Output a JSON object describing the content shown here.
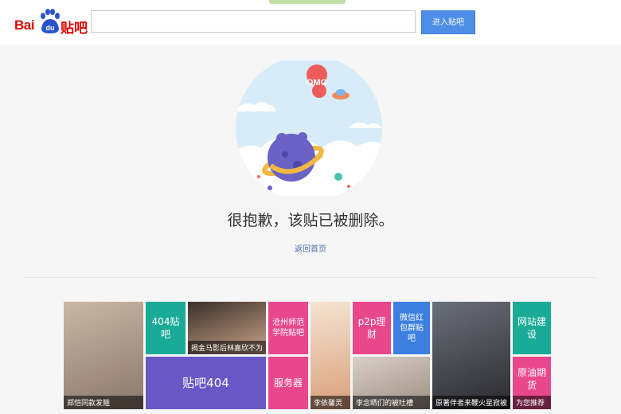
{
  "header": {
    "logo_bai": "Bai",
    "logo_du": "du",
    "logo_tieba": "贴吧",
    "search_value": "",
    "enter_label": "进入贴吧"
  },
  "illustration": {
    "badge_text": "OMG"
  },
  "main": {
    "message": "很抱歉，该贴已被删除。",
    "home_link": "返回首页"
  },
  "tiles": [
    {
      "caption": "郑恺同款发箍"
    },
    {
      "text": "404贴吧"
    },
    {
      "caption": "揭金马影后林嘉欣不为"
    },
    {
      "text": "沧州师范学院贴吧"
    },
    {
      "text": "贴吧404"
    },
    {
      "text": "服务器"
    },
    {
      "caption": "李依馨灵"
    },
    {
      "text": "p2p理财"
    },
    {
      "text": "微信红包群贴吧"
    },
    {
      "caption": "李念晒们的被吐槽"
    },
    {
      "caption": "原著伴者来鞭火星寂被"
    },
    {
      "text": "网站建设"
    },
    {
      "text": "原油期货"
    },
    {
      "caption": "为您推荐"
    }
  ],
  "colors": {
    "brand_red": "#e10602",
    "button_blue": "#4e8ee9",
    "tile_teal": "#1aab96",
    "tile_purple": "#6a57c6",
    "tile_pink": "#e9478c",
    "tile_blue": "#3d7fe0"
  }
}
